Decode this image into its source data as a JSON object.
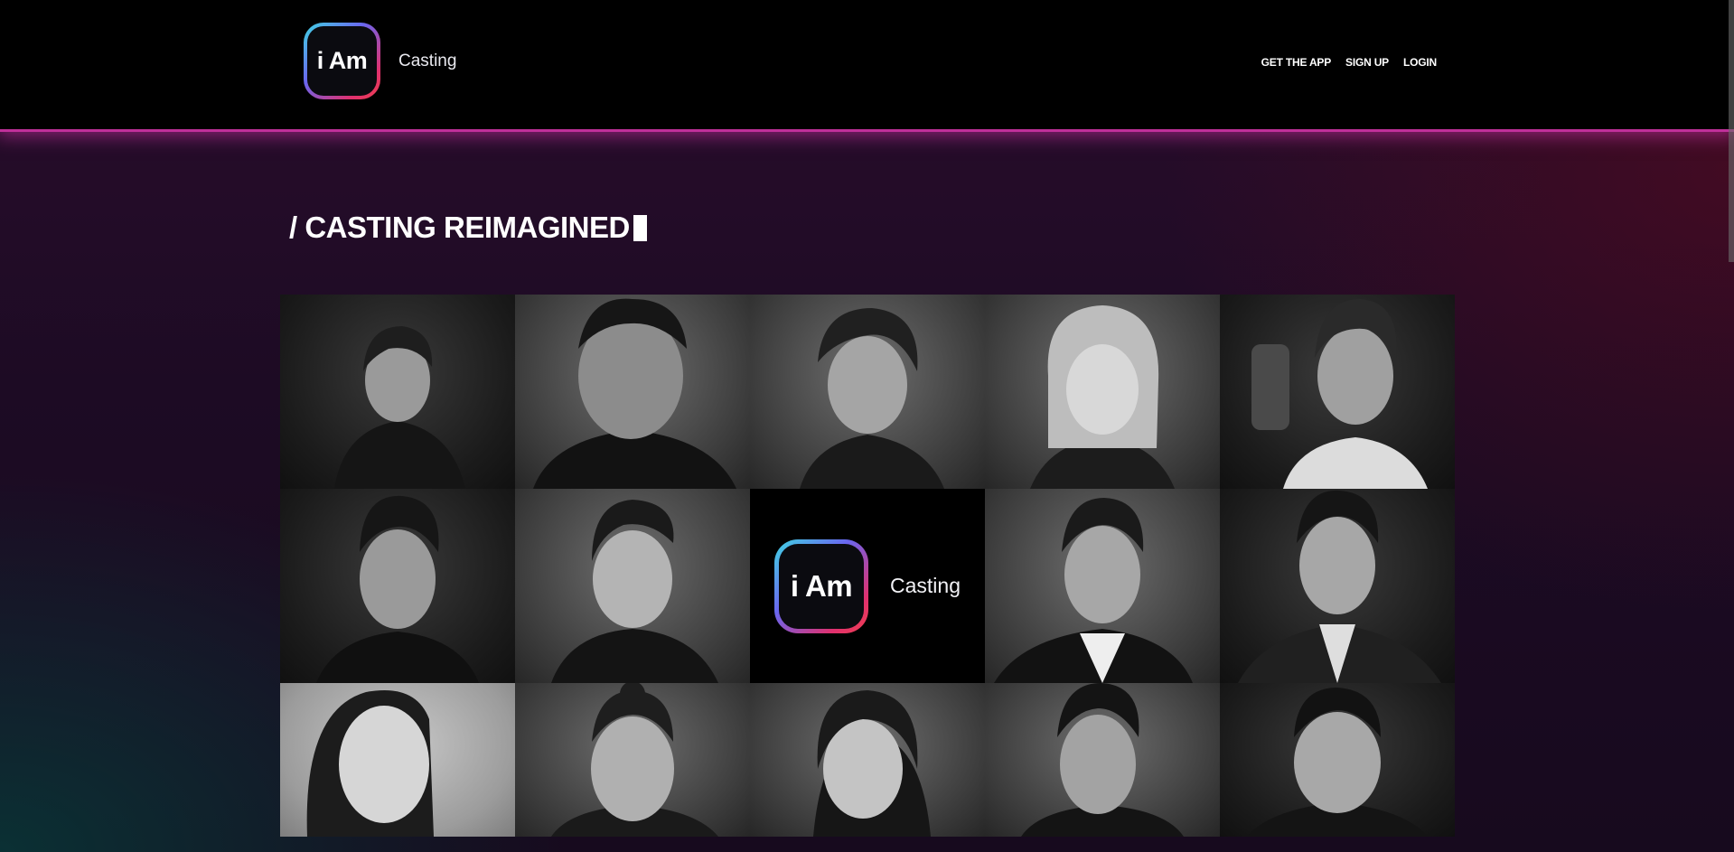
{
  "header": {
    "logo_mark": "i Am",
    "logo_text": "Casting",
    "nav": [
      "GET THE APP",
      "SIGN UP",
      "LOGIN"
    ]
  },
  "hero": {
    "headline": "/ CASTING REIMAGINED"
  },
  "grid": {
    "center_logo_mark": "i Am",
    "center_logo_text": "Casting"
  },
  "colors": {
    "accent_glow": "#c0309a",
    "logo_gradient_start": "#3fd6e2",
    "logo_gradient_end": "#f04050"
  }
}
